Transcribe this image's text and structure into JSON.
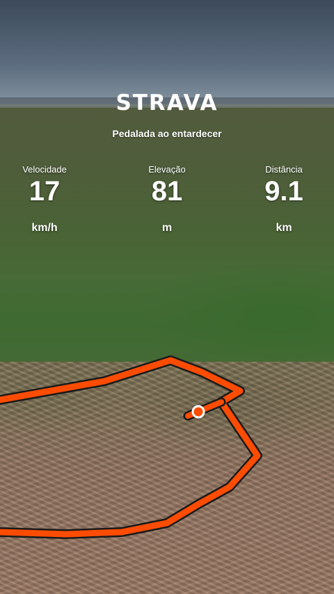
{
  "brand": {
    "logo_text": "STRAVA"
  },
  "activity": {
    "title": "Pedalada ao entardecer"
  },
  "stats": {
    "speed": {
      "label": "Velocidade",
      "value": "17",
      "unit": "km/h"
    },
    "elevation": {
      "label": "Elevação",
      "value": "81",
      "unit": "m"
    },
    "distance": {
      "label": "Distância",
      "value": "9.1",
      "unit": "km"
    }
  },
  "colors": {
    "route": "#fc4c02",
    "route_outline": "#1a1a1a",
    "text": "#ffffff"
  },
  "icons": {
    "current_position": "position-marker-icon"
  }
}
